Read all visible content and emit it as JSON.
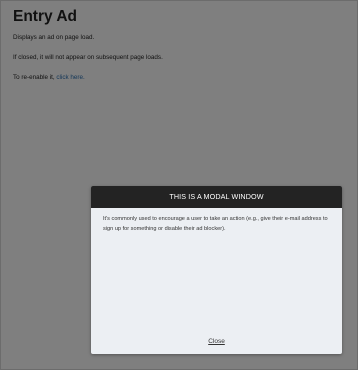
{
  "page": {
    "title": "Entry Ad",
    "description": "Displays an ad on page load.",
    "closed_note": "If closed, it will not appear on subsequent page loads.",
    "reenable_prefix": "To re-enable it, ",
    "reenable_link": "click here."
  },
  "modal": {
    "title": "THIS IS A MODAL WINDOW",
    "body": "It's commonly used to encourage a user to take an action (e.g., give their e-mail address to sign up for something or disable their ad blocker).",
    "close_label": "Close"
  },
  "colors": {
    "overlay": "#000000",
    "modal_header": "#232323",
    "modal_body": "#eceff3",
    "link": "#2a6fb0"
  }
}
